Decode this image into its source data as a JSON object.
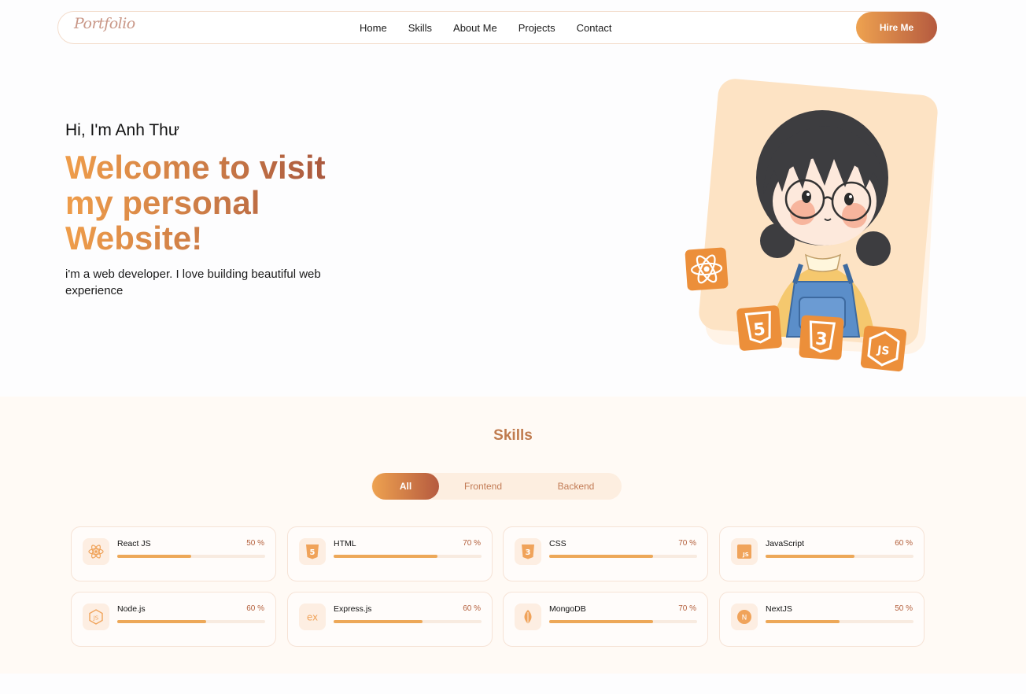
{
  "nav": {
    "logo": "Portfolio",
    "links": [
      "Home",
      "Skills",
      "About Me",
      "Projects",
      "Contact"
    ],
    "cta": "Hire Me"
  },
  "hero": {
    "greeting": "Hi, I'm Anh Thư",
    "headline": "Welcome to visit my personal Website!",
    "intro": "i'm a web developer. I love building beautiful web experience"
  },
  "skills": {
    "title": "Skills",
    "filters": [
      "All",
      "Frontend",
      "Backend"
    ],
    "active_filter": "All",
    "items": [
      {
        "name": "React JS",
        "percent_label": "50 %",
        "level": 0.5,
        "icon": "react-icon"
      },
      {
        "name": "HTML",
        "percent_label": "70 %",
        "level": 0.7,
        "icon": "html5-icon"
      },
      {
        "name": "CSS",
        "percent_label": "70 %",
        "level": 0.7,
        "icon": "css3-icon"
      },
      {
        "name": "JavaScript",
        "percent_label": "60 %",
        "level": 0.6,
        "icon": "javascript-icon"
      },
      {
        "name": "Node.js",
        "percent_label": "60 %",
        "level": 0.6,
        "icon": "nodejs-icon"
      },
      {
        "name": "Express.js",
        "percent_label": "60 %",
        "level": 0.6,
        "icon": "express-icon"
      },
      {
        "name": "MongoDB",
        "percent_label": "70 %",
        "level": 0.7,
        "icon": "mongodb-icon"
      },
      {
        "name": "NextJS",
        "percent_label": "50 %",
        "level": 0.5,
        "icon": "nextjs-icon"
      }
    ]
  },
  "colors": {
    "accent_start": "#eea250",
    "accent_end": "#b55a3f",
    "bar": "#eda858",
    "skills_bg": "#fffaf5"
  }
}
